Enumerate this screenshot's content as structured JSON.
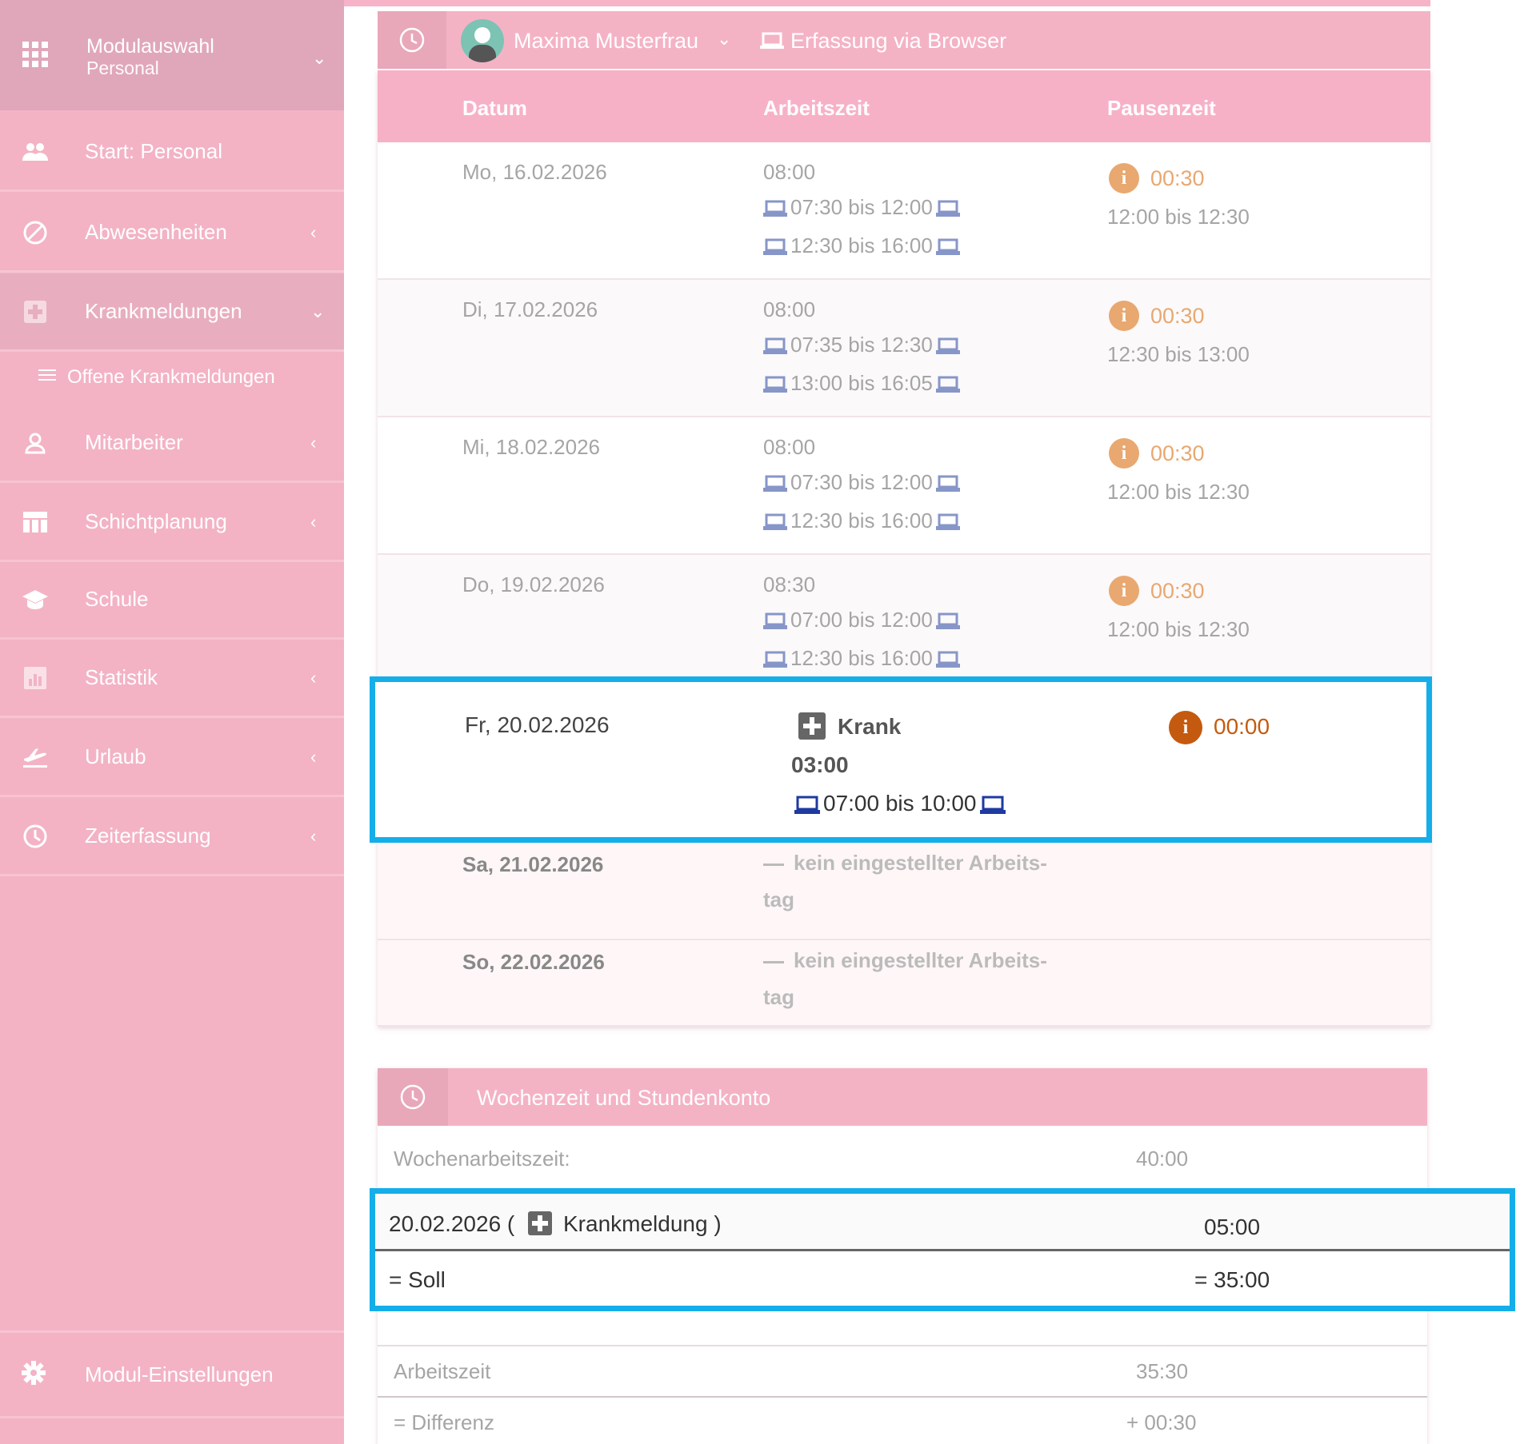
{
  "sidebar": {
    "header_title": "Modulauswahl",
    "header_subtitle": "Personal",
    "items": [
      {
        "label": "Start: Personal"
      },
      {
        "label": "Abwesenheiten"
      },
      {
        "label": "Krankmeldungen"
      },
      {
        "label": "Offene Krankmeldungen"
      },
      {
        "label": "Mitarbeiter"
      },
      {
        "label": "Schichtplanung"
      },
      {
        "label": "Schule"
      },
      {
        "label": "Statistik"
      },
      {
        "label": "Urlaub"
      },
      {
        "label": "Zeiterfassung"
      }
    ],
    "settings_label": "Modul-Einstellungen"
  },
  "header": {
    "user_name": "Maxima Musterfrau",
    "mode": "Erfassung via Browser"
  },
  "table": {
    "columns": [
      "Datum",
      "Arbeitszeit",
      "Pausenzeit"
    ],
    "rows": [
      {
        "date": "Mo, 16.02.2026",
        "total": "08:00",
        "ranges": [
          "07:30 bis 12:00",
          "12:30 bis 16:00"
        ],
        "pause": "00:30",
        "pause_range": "12:00 bis 12:30"
      },
      {
        "date": "Di, 17.02.2026",
        "total": "08:00",
        "ranges": [
          "07:35 bis 12:30",
          "13:00 bis 16:05"
        ],
        "pause": "00:30",
        "pause_range": "12:30 bis 13:00"
      },
      {
        "date": "Mi, 18.02.2026",
        "total": "08:00",
        "ranges": [
          "07:30 bis 12:00",
          "12:30 bis 16:00"
        ],
        "pause": "00:30",
        "pause_range": "12:00 bis 12:30"
      },
      {
        "date": "Do, 19.02.2026",
        "total": "08:30",
        "ranges": [
          "07:00 bis 12:00",
          "12:30 bis 16:00"
        ],
        "pause": "00:30",
        "pause_range": "12:00 bis 12:30"
      }
    ],
    "sick_row": {
      "date": "Fr, 20.02.2026",
      "status": "Krank",
      "total": "03:00",
      "range": "07:00 bis 10:00",
      "pause": "00:00"
    },
    "weekend": [
      {
        "date": "Sa, 21.02.2026",
        "line1": "kein eingestellter Arbeits-",
        "line2": "tag"
      },
      {
        "date": "So, 22.02.2026",
        "line1": "kein eingestellter Arbeits-",
        "line2": "tag"
      }
    ]
  },
  "summary": {
    "title": "Wochenzeit und Stundenkonto",
    "wochenarbeitszeit_label": "Wochenarbeitszeit:",
    "wochenarbeitszeit_value": "40:00",
    "sick_date": "20.02.2026 (",
    "sick_label": "Krankmeldung )",
    "sick_value": "05:00",
    "soll_label": "= Soll",
    "soll_value": "= 35:00",
    "arbeitszeit_label": "Arbeitszeit",
    "arbeitszeit_value": "35:30",
    "differenz_label": "= Differenz",
    "differenz_value": "+ 00:30"
  },
  "colors": {
    "sidebar": "#f3b3c5",
    "header": "#f4b3c5",
    "highlight": "#14aee8",
    "pause": "#e8a870",
    "laptop": "#1f3aa0"
  }
}
